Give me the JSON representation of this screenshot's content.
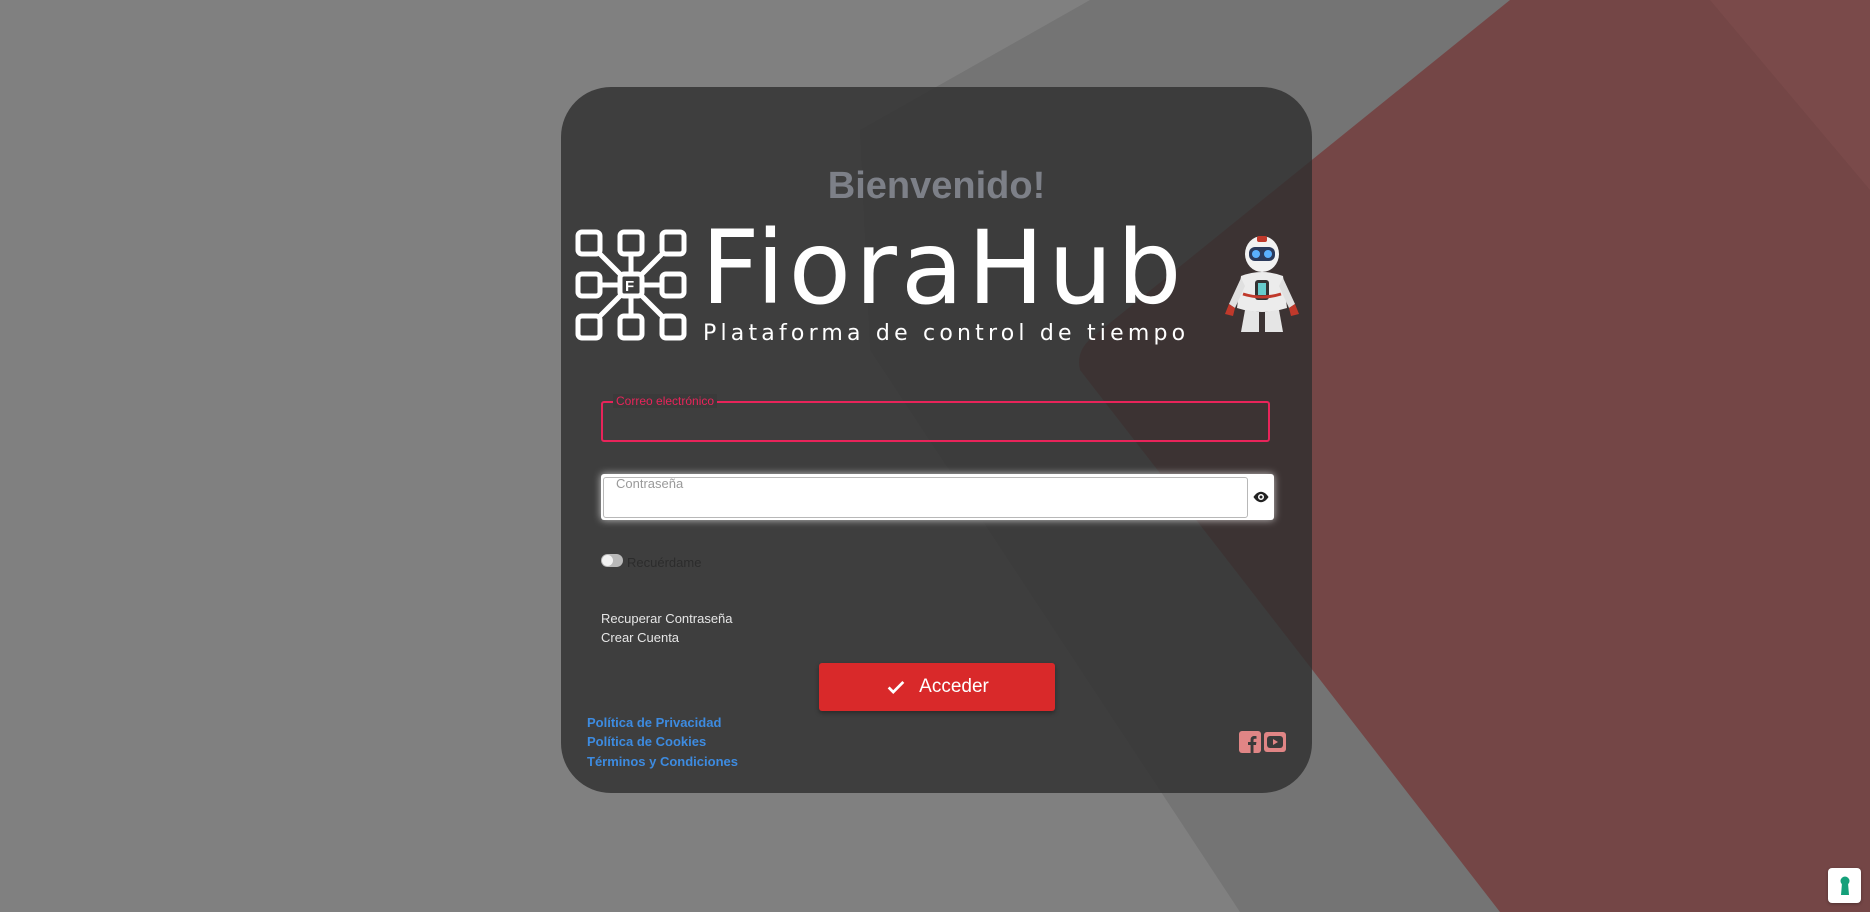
{
  "colors": {
    "background": "#808080",
    "card": "#3a3a3a",
    "accent_red": "#d9292a",
    "field_highlight": "#e8245a",
    "link_blue": "#3d8be0",
    "welcome_text": "#7d8088"
  },
  "header": {
    "welcome": "Bienvenido!"
  },
  "logo": {
    "icon": "fiorahub-grid-logo-icon",
    "brand": "FioraHub",
    "tagline": "Plataforma de control de tiempo",
    "mascot": "robot-icon"
  },
  "form": {
    "email_label": "Correo electrónico",
    "email_value": "",
    "password_label": "Contraseña",
    "password_value": "",
    "show_password_icon": "eye-icon",
    "remember_label": "Recuérdame",
    "remember_checked": false,
    "recover_link": "Recuperar Contraseña",
    "create_link": "Crear Cuenta",
    "submit_label": "Acceder",
    "submit_icon": "check-icon"
  },
  "footer": {
    "links": [
      "Política de Privacidad",
      "Política de Cookies",
      "Términos y Condiciones"
    ],
    "social_icons": [
      "facebook-icon",
      "youtube-icon"
    ]
  },
  "cookie_widget": {
    "icon": "keyhole-icon"
  }
}
